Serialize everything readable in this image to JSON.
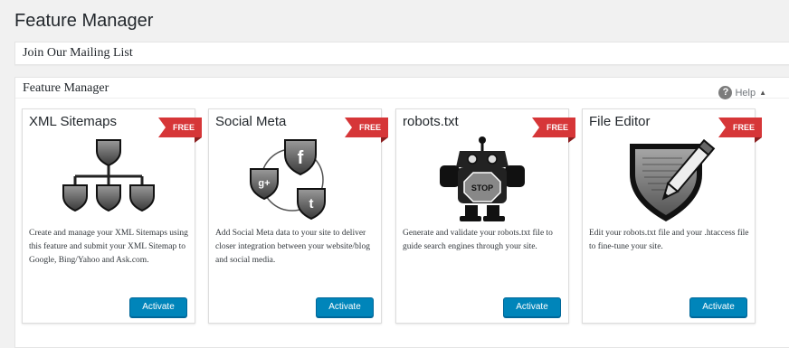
{
  "page": {
    "title": "Feature Manager"
  },
  "mailing_panel": {
    "title": "Join Our Mailing List"
  },
  "features_panel": {
    "title": "Feature Manager",
    "help_label": "Help",
    "help_symbol": "?",
    "help_caret": "▲"
  },
  "cards": [
    {
      "title": "XML Sitemaps",
      "badge": "FREE",
      "icon": "sitemap-hierarchy-icon",
      "description": "Create and manage your XML Sitemaps using this feature and submit your XML Sitemap to Google, Bing/Yahoo and Ask.com.",
      "button": "Activate"
    },
    {
      "title": "Social Meta",
      "badge": "FREE",
      "icon": "social-shields-icon",
      "description": "Add Social Meta data to your site to deliver closer integration between your website/blog and social media.",
      "button": "Activate"
    },
    {
      "title": "robots.txt",
      "badge": "FREE",
      "icon": "robot-stop-icon",
      "icon_text": "STOP",
      "description": "Generate and validate your robots.txt file to guide search engines through your site.",
      "button": "Activate"
    },
    {
      "title": "File Editor",
      "badge": "FREE",
      "icon": "shield-pencil-icon",
      "description": "Edit your robots.txt file and your .htaccess file to fine-tune your site.",
      "button": "Activate"
    }
  ],
  "colors": {
    "badge": "#d63638",
    "button": "#0085ba",
    "background": "#f1f1f1"
  }
}
